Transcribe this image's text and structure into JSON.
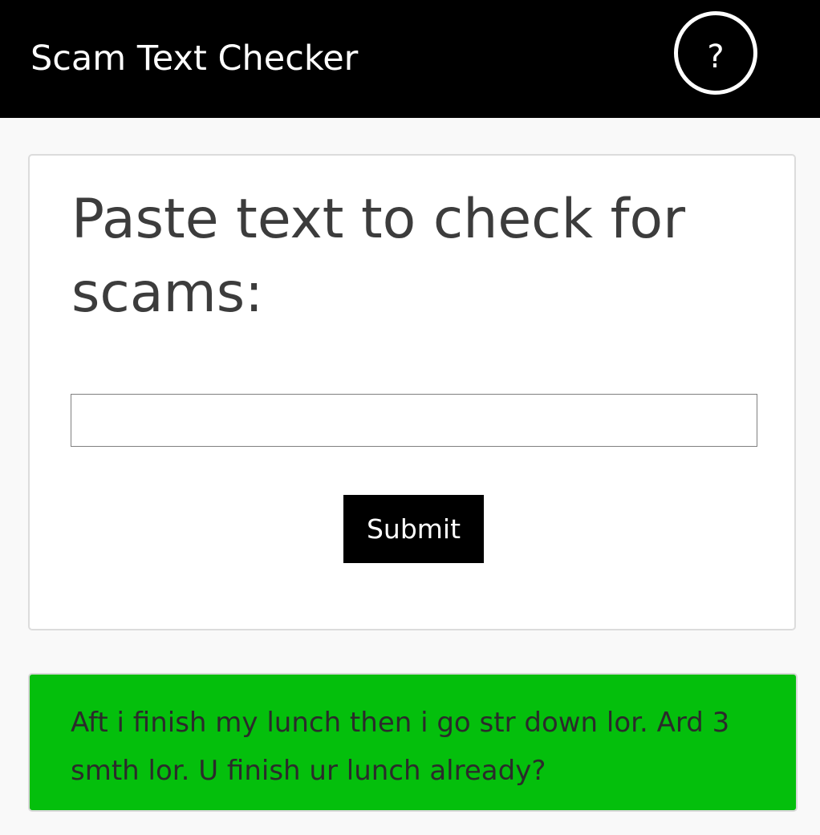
{
  "header": {
    "title": "Scam Text Checker",
    "help_label": "?"
  },
  "form": {
    "heading": "Paste text to check for scams:",
    "input_value": "",
    "input_placeholder": "",
    "submit_label": "Submit"
  },
  "result": {
    "message": "Aft i finish my lunch then i go str down lor. Ard 3 smth lor. U finish ur lunch already?",
    "status_color": "#04bf0c"
  },
  "colors": {
    "navbar": "#000000",
    "page_background": "#f9f9f9",
    "result_safe": "#04bf0c"
  }
}
